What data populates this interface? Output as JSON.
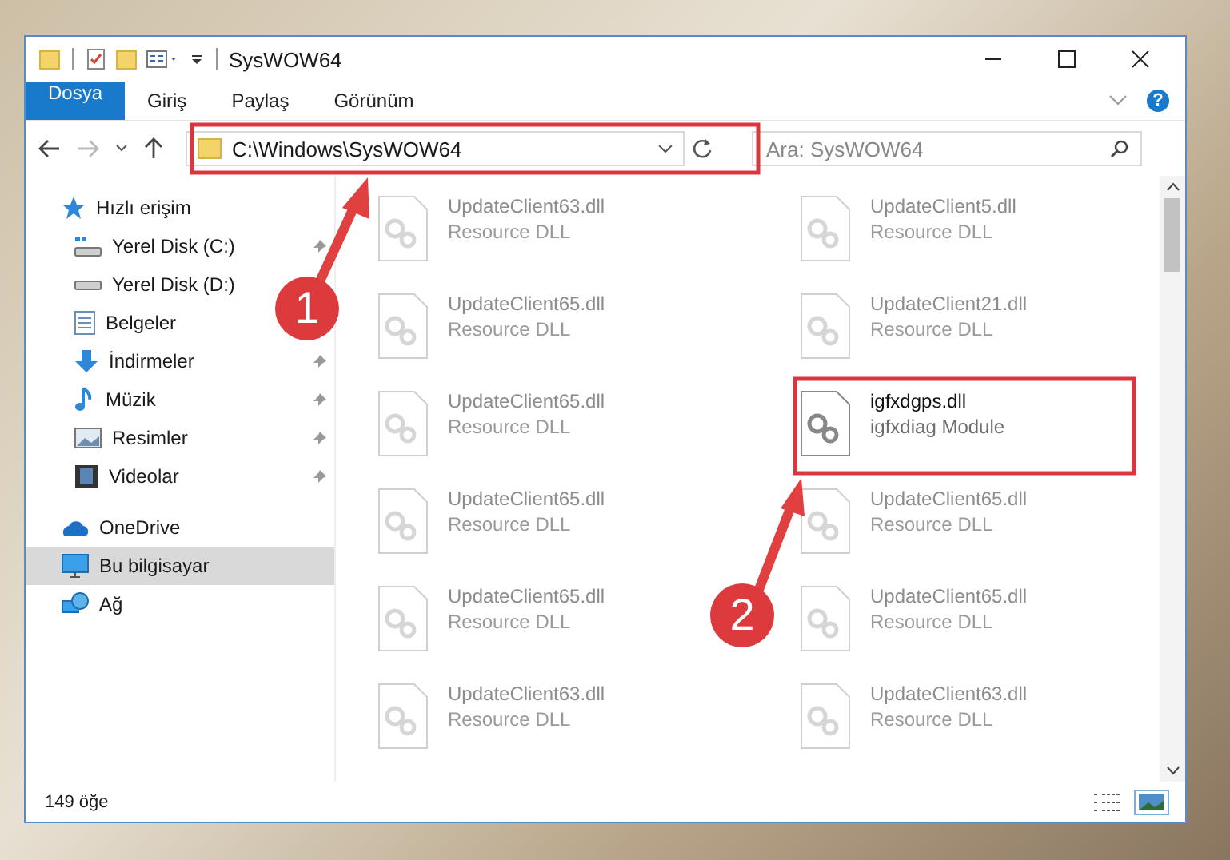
{
  "window": {
    "title": "SysWOW64",
    "help": "?"
  },
  "ribbon_tabs": [
    {
      "label": "Dosya",
      "kind": "file"
    },
    {
      "label": "Giriş",
      "kind": "tab"
    },
    {
      "label": "Paylaş",
      "kind": "tab"
    },
    {
      "label": "Görünüm",
      "kind": "tab"
    }
  ],
  "address_bar": {
    "path": "C:\\Windows\\SysWOW64"
  },
  "search": {
    "placeholder": "Ara: SysWOW64"
  },
  "sidebar": {
    "items": [
      {
        "label": "Hızlı erişim",
        "kind": "star",
        "selected": false,
        "children": [
          {
            "label": "Yerel Disk (C:)",
            "kind": "drive-c",
            "pinned": true,
            "selected": false
          },
          {
            "label": "Yerel Disk (D:)",
            "kind": "drive",
            "pinned": false,
            "selected": false
          },
          {
            "label": "Belgeler",
            "kind": "docs",
            "pinned": false,
            "selected": false
          },
          {
            "label": "İndirmeler",
            "kind": "download",
            "pinned": true,
            "selected": false
          },
          {
            "label": "Müzik",
            "kind": "music",
            "pinned": true,
            "selected": false
          },
          {
            "label": "Resimler",
            "kind": "pictures",
            "pinned": true,
            "selected": false
          },
          {
            "label": "Videolar",
            "kind": "videos",
            "pinned": true,
            "selected": false
          }
        ]
      },
      {
        "label": "OneDrive",
        "kind": "cloud",
        "selected": false
      },
      {
        "label": "Bu bilgisayar",
        "kind": "pc",
        "selected": true
      },
      {
        "label": "Ağ",
        "kind": "network",
        "selected": false
      }
    ]
  },
  "files": [
    {
      "name": "UpdateClient63.dll",
      "type": "Resource DLL",
      "highlighted": false
    },
    {
      "name": "UpdateClient5.dll",
      "type": "Resource DLL",
      "highlighted": false
    },
    {
      "name": "UpdateClient65.dll",
      "type": "Resource DLL",
      "highlighted": false
    },
    {
      "name": "UpdateClient21.dll",
      "type": "Resource DLL",
      "highlighted": false
    },
    {
      "name": "UpdateClient65.dll",
      "type": "Resource DLL",
      "highlighted": false
    },
    {
      "name": "igfxdgps.dll",
      "type": "igfxdiag Module",
      "highlighted": true
    },
    {
      "name": "UpdateClient65.dll",
      "type": "Resource DLL",
      "highlighted": false
    },
    {
      "name": "UpdateClient65.dll",
      "type": "Resource DLL",
      "highlighted": false
    },
    {
      "name": "UpdateClient65.dll",
      "type": "Resource DLL",
      "highlighted": false
    },
    {
      "name": "UpdateClient65.dll",
      "type": "Resource DLL",
      "highlighted": false
    },
    {
      "name": "UpdateClient63.dll",
      "type": "Resource DLL",
      "highlighted": false
    },
    {
      "name": "UpdateClient63.dll",
      "type": "Resource DLL",
      "highlighted": false
    }
  ],
  "status_bar": {
    "count": "149 öğe",
    "views": [
      {
        "kind": "details",
        "selected": false
      },
      {
        "kind": "large-icons",
        "selected": true
      }
    ]
  },
  "annotations": [
    {
      "number": "1"
    },
    {
      "number": "2"
    }
  ]
}
